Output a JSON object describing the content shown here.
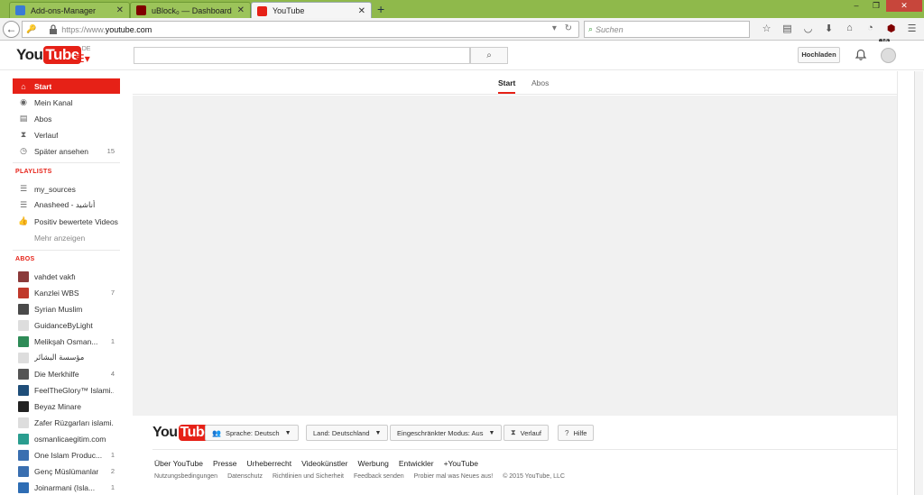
{
  "browser": {
    "tabs": [
      {
        "title": "Add-ons-Manager",
        "favicon_color": "#3a7bd5"
      },
      {
        "title": "uBlock₀ — Dashboard",
        "favicon_color": "#800000"
      },
      {
        "title": "YouTube",
        "favicon_color": "#e62117",
        "active": true
      }
    ],
    "new_tab_label": "+",
    "window_controls": {
      "minimize": "–",
      "restore": "❐",
      "close": "✕"
    },
    "url": {
      "scheme": "https://www.",
      "host": "youtube.com"
    },
    "search_placeholder": "Suchen",
    "ublock_badge": "16"
  },
  "masthead": {
    "logo_you": "You",
    "logo_tube": "Tube",
    "logo_region": "DE",
    "search_button_icon": "⌕",
    "upload_label": "Hochladen"
  },
  "guide": {
    "main": [
      {
        "label": "Start",
        "icon": "⌂",
        "active": true
      },
      {
        "label": "Mein Kanal",
        "icon": "◉"
      },
      {
        "label": "Abos",
        "icon": "▤"
      },
      {
        "label": "Verlauf",
        "icon": "⧗"
      },
      {
        "label": "Später ansehen",
        "icon": "◷",
        "count": "15"
      }
    ],
    "playlists_heading": "PLAYLISTS",
    "playlists": [
      {
        "label": "my_sources",
        "icon": "☰"
      },
      {
        "label": "Anasheed - أناشيد",
        "icon": "☰"
      },
      {
        "label": "Positiv bewertete Videos",
        "icon": "👍"
      }
    ],
    "more_label": "Mehr anzeigen",
    "subscriptions_heading": "ABOS",
    "subscriptions": [
      {
        "label": "vahdet vakfı",
        "color": "#8b3a3a"
      },
      {
        "label": "Kanzlei WBS",
        "color": "#c0392b",
        "count": "7"
      },
      {
        "label": "Syrian Muslim",
        "color": "#4a4a4a"
      },
      {
        "label": "GuidanceByLight",
        "color": "#dddddd"
      },
      {
        "label": "Melikşah Osman...",
        "color": "#2e8b57",
        "count": "1"
      },
      {
        "label": "مؤسسة البشائر",
        "color": "#dddddd"
      },
      {
        "label": "Die Merkhilfe",
        "color": "#555555",
        "count": "4"
      },
      {
        "label": "FeelTheGlory™ Islami...",
        "color": "#1f4e79"
      },
      {
        "label": "Beyaz Minare",
        "color": "#222222"
      },
      {
        "label": "Zafer Rüzgarları islami...",
        "color": "#dddddd"
      },
      {
        "label": "osmanlicaegitim.com",
        "color": "#2a9d8f"
      },
      {
        "label": "One Islam Produc...",
        "color": "#3a6fb0",
        "count": "1"
      },
      {
        "label": "Genç Müslümanlar",
        "color": "#3a6fb0",
        "count": "2"
      },
      {
        "label": "Joinarmani (Isla...",
        "color": "#2e6db4",
        "count": "1"
      }
    ]
  },
  "content": {
    "tabs": [
      {
        "label": "Start",
        "active": true
      },
      {
        "label": "Abos"
      }
    ]
  },
  "footer": {
    "logo_you": "You",
    "logo_tube": "Tube",
    "buttons": [
      {
        "label": "Sprache: Deutsch",
        "icon": "👥",
        "dropdown": true
      },
      {
        "label": "Land: Deutschland",
        "dropdown": true
      },
      {
        "label": "Eingeschränkter Modus: Aus",
        "dropdown": true
      },
      {
        "label": "Verlauf",
        "icon": "⧗"
      },
      {
        "label": "Hilfe",
        "icon": "?"
      }
    ],
    "links_primary": [
      "Über YouTube",
      "Presse",
      "Urheberrecht",
      "Videokünstler",
      "Werbung",
      "Entwickler",
      "+YouTube"
    ],
    "links_secondary": [
      "Nutzungsbedingungen",
      "Datenschutz",
      "Richtlinien und Sicherheit",
      "Feedback senden",
      "Probier mal was Neues aus!",
      "© 2015 YouTube, LLC"
    ]
  }
}
